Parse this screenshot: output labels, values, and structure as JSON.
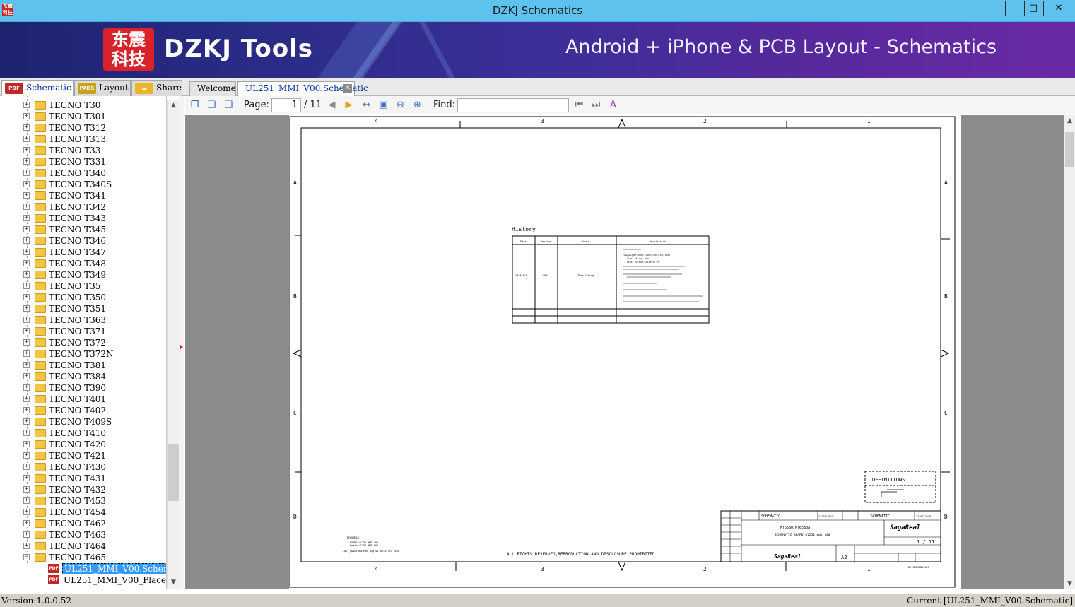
{
  "window": {
    "title": "DZKJ Schematics",
    "icon_text": "东震\n科技",
    "controls": [
      "minimize-icon",
      "maximize-icon",
      "close-icon"
    ]
  },
  "banner": {
    "logo_text": "东震科技",
    "brand": "DZKJ Tools",
    "tagline": "Android + iPhone & PCB Layout - Schematics"
  },
  "left_tabs": [
    {
      "label": "Schematic",
      "icon": "PDF"
    },
    {
      "label": "Layout",
      "icon": "PADS"
    },
    {
      "label": "Share",
      "icon": "share-icon"
    }
  ],
  "doc_tabs": [
    {
      "label": "Welcome"
    },
    {
      "label": "UL251_MMI_V00.Schematic"
    }
  ],
  "tree": {
    "folders": [
      "TECNO T30",
      "TECNO T301",
      "TECNO T312",
      "TECNO T313",
      "TECNO T33",
      "TECNO T331",
      "TECNO T340",
      "TECNO T340S",
      "TECNO T341",
      "TECNO T342",
      "TECNO T343",
      "TECNO T345",
      "TECNO T346",
      "TECNO T347",
      "TECNO T348",
      "TECNO T349",
      "TECNO T35",
      "TECNO T350",
      "TECNO T351",
      "TECNO T363",
      "TECNO T371",
      "TECNO T372",
      "TECNO T372N",
      "TECNO T381",
      "TECNO T384",
      "TECNO T390",
      "TECNO T401",
      "TECNO T402",
      "TECNO T409S",
      "TECNO T410",
      "TECNO T420",
      "TECNO T421",
      "TECNO T430",
      "TECNO T431",
      "TECNO T432",
      "TECNO T453",
      "TECNO T454",
      "TECNO T462",
      "TECNO T463",
      "TECNO T464",
      "TECNO T465"
    ],
    "expanded_folder": "TECNO T465",
    "files": [
      "UL251_MMI_V00.Schematic",
      "UL251_MMI_V00_Placement"
    ],
    "selected_file": "UL251_MMI_V00.Schematic"
  },
  "toolbar": {
    "page_label": "Page:",
    "page_value": "1",
    "page_total": "/ 11",
    "find_label": "Find:",
    "find_value": ""
  },
  "sheet": {
    "col_labels": [
      "4",
      "3",
      "2",
      "1"
    ],
    "row_labels": [
      "A",
      "B",
      "C",
      "D"
    ],
    "history_title": "History",
    "history_headers": [
      "Date",
      "Version",
      "Owner",
      "Description"
    ],
    "history_row": {
      "date": "2018/7/6",
      "version": "V00",
      "owner": "Zhao Jiming"
    },
    "notes_small": [
      "Changes[NOT-V00]: CS06:C387/C37C:C393",
      "U7101->F4133, T40",
      "CS033 PCC3433->PCC3433 0T"
    ],
    "definitions": "DEFINITIONS",
    "footer_notice": "ALL RIGHTS RESERVED,REPRODUCTION AND DISCLOSURE PROHIBITED",
    "drawing_block": [
      "DRAWING:",
      "BOARD UL251 MMI V00",
      "Board ul251 MMI V00",
      "LAST_MODIFIED=Mon Aug 01 09:34:17 2018"
    ],
    "title_block": {
      "name1": "SCHEMATIC",
      "date1": "27/07/2018",
      "name2": "SCHEMATIC",
      "date2": "27/07/2018",
      "title": "MT6580/MT6580A",
      "product": "SCHEMATIC BOARD ul251_mmi_v00",
      "format": "A2",
      "sheet": "1 / 11",
      "company": "SagaReal",
      "footer_mark": "BY SHIMANG HDS"
    }
  },
  "status": {
    "version": "Version:1.0.0.52",
    "current": "Current [UL251_MMI_V00.Schematic]"
  }
}
